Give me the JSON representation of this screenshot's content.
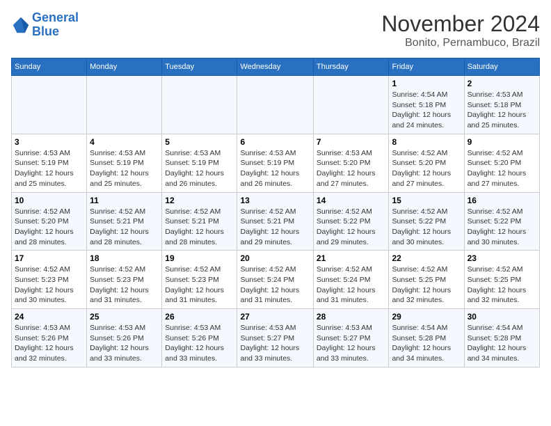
{
  "logo": {
    "line1": "General",
    "line2": "Blue"
  },
  "title": "November 2024",
  "subtitle": "Bonito, Pernambuco, Brazil",
  "weekdays": [
    "Sunday",
    "Monday",
    "Tuesday",
    "Wednesday",
    "Thursday",
    "Friday",
    "Saturday"
  ],
  "weeks": [
    [
      {
        "day": "",
        "info": ""
      },
      {
        "day": "",
        "info": ""
      },
      {
        "day": "",
        "info": ""
      },
      {
        "day": "",
        "info": ""
      },
      {
        "day": "",
        "info": ""
      },
      {
        "day": "1",
        "info": "Sunrise: 4:54 AM\nSunset: 5:18 PM\nDaylight: 12 hours and 24 minutes."
      },
      {
        "day": "2",
        "info": "Sunrise: 4:53 AM\nSunset: 5:18 PM\nDaylight: 12 hours and 25 minutes."
      }
    ],
    [
      {
        "day": "3",
        "info": "Sunrise: 4:53 AM\nSunset: 5:19 PM\nDaylight: 12 hours and 25 minutes."
      },
      {
        "day": "4",
        "info": "Sunrise: 4:53 AM\nSunset: 5:19 PM\nDaylight: 12 hours and 25 minutes."
      },
      {
        "day": "5",
        "info": "Sunrise: 4:53 AM\nSunset: 5:19 PM\nDaylight: 12 hours and 26 minutes."
      },
      {
        "day": "6",
        "info": "Sunrise: 4:53 AM\nSunset: 5:19 PM\nDaylight: 12 hours and 26 minutes."
      },
      {
        "day": "7",
        "info": "Sunrise: 4:53 AM\nSunset: 5:20 PM\nDaylight: 12 hours and 27 minutes."
      },
      {
        "day": "8",
        "info": "Sunrise: 4:52 AM\nSunset: 5:20 PM\nDaylight: 12 hours and 27 minutes."
      },
      {
        "day": "9",
        "info": "Sunrise: 4:52 AM\nSunset: 5:20 PM\nDaylight: 12 hours and 27 minutes."
      }
    ],
    [
      {
        "day": "10",
        "info": "Sunrise: 4:52 AM\nSunset: 5:20 PM\nDaylight: 12 hours and 28 minutes."
      },
      {
        "day": "11",
        "info": "Sunrise: 4:52 AM\nSunset: 5:21 PM\nDaylight: 12 hours and 28 minutes."
      },
      {
        "day": "12",
        "info": "Sunrise: 4:52 AM\nSunset: 5:21 PM\nDaylight: 12 hours and 28 minutes."
      },
      {
        "day": "13",
        "info": "Sunrise: 4:52 AM\nSunset: 5:21 PM\nDaylight: 12 hours and 29 minutes."
      },
      {
        "day": "14",
        "info": "Sunrise: 4:52 AM\nSunset: 5:22 PM\nDaylight: 12 hours and 29 minutes."
      },
      {
        "day": "15",
        "info": "Sunrise: 4:52 AM\nSunset: 5:22 PM\nDaylight: 12 hours and 30 minutes."
      },
      {
        "day": "16",
        "info": "Sunrise: 4:52 AM\nSunset: 5:22 PM\nDaylight: 12 hours and 30 minutes."
      }
    ],
    [
      {
        "day": "17",
        "info": "Sunrise: 4:52 AM\nSunset: 5:23 PM\nDaylight: 12 hours and 30 minutes."
      },
      {
        "day": "18",
        "info": "Sunrise: 4:52 AM\nSunset: 5:23 PM\nDaylight: 12 hours and 31 minutes."
      },
      {
        "day": "19",
        "info": "Sunrise: 4:52 AM\nSunset: 5:23 PM\nDaylight: 12 hours and 31 minutes."
      },
      {
        "day": "20",
        "info": "Sunrise: 4:52 AM\nSunset: 5:24 PM\nDaylight: 12 hours and 31 minutes."
      },
      {
        "day": "21",
        "info": "Sunrise: 4:52 AM\nSunset: 5:24 PM\nDaylight: 12 hours and 31 minutes."
      },
      {
        "day": "22",
        "info": "Sunrise: 4:52 AM\nSunset: 5:25 PM\nDaylight: 12 hours and 32 minutes."
      },
      {
        "day": "23",
        "info": "Sunrise: 4:52 AM\nSunset: 5:25 PM\nDaylight: 12 hours and 32 minutes."
      }
    ],
    [
      {
        "day": "24",
        "info": "Sunrise: 4:53 AM\nSunset: 5:26 PM\nDaylight: 12 hours and 32 minutes."
      },
      {
        "day": "25",
        "info": "Sunrise: 4:53 AM\nSunset: 5:26 PM\nDaylight: 12 hours and 33 minutes."
      },
      {
        "day": "26",
        "info": "Sunrise: 4:53 AM\nSunset: 5:26 PM\nDaylight: 12 hours and 33 minutes."
      },
      {
        "day": "27",
        "info": "Sunrise: 4:53 AM\nSunset: 5:27 PM\nDaylight: 12 hours and 33 minutes."
      },
      {
        "day": "28",
        "info": "Sunrise: 4:53 AM\nSunset: 5:27 PM\nDaylight: 12 hours and 33 minutes."
      },
      {
        "day": "29",
        "info": "Sunrise: 4:54 AM\nSunset: 5:28 PM\nDaylight: 12 hours and 34 minutes."
      },
      {
        "day": "30",
        "info": "Sunrise: 4:54 AM\nSunset: 5:28 PM\nDaylight: 12 hours and 34 minutes."
      }
    ]
  ]
}
